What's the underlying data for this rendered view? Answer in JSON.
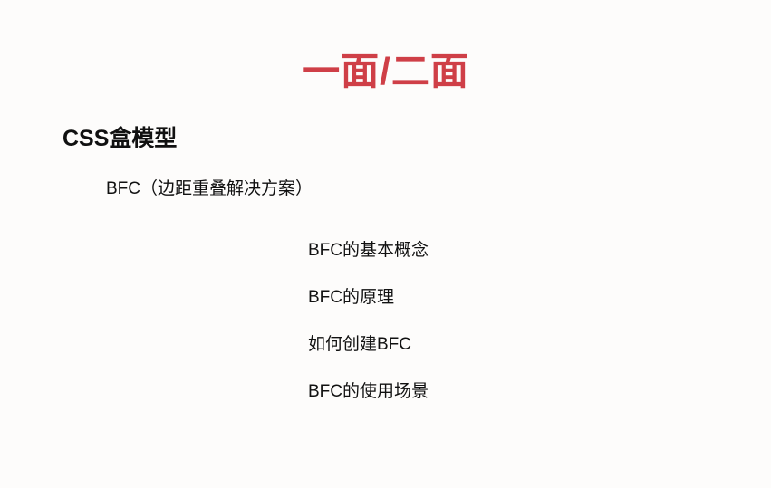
{
  "slide": {
    "title": "一面/二面",
    "section_heading": "CSS盒模型",
    "subheading": "BFC（边距重叠解决方案）",
    "points": [
      "BFC的基本概念",
      "BFC的原理",
      "如何创建BFC",
      "BFC的使用场景"
    ]
  },
  "colors": {
    "title": "#cf3f47",
    "text": "#111111",
    "background": "#fdfcfb"
  }
}
